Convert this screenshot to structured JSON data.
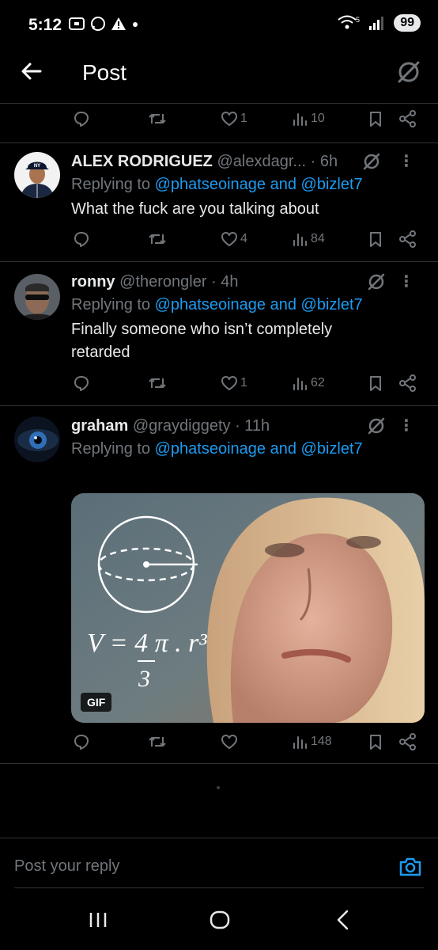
{
  "status_bar": {
    "time": "5:12",
    "battery": "99",
    "signal_label": "5"
  },
  "header": {
    "title": "Post"
  },
  "top_actions": {
    "likes": "1",
    "views": "10"
  },
  "tweets": [
    {
      "name": "ALEX RODRIGUEZ",
      "handle": "@alexdagr...",
      "time": "· 6h",
      "replying_prefix": "Replying to ",
      "mention1": "@phatseoinage",
      "and": " and ",
      "mention2": "@bizlet7",
      "text": "What the fuck are you talking about",
      "likes": "4",
      "views": "84"
    },
    {
      "name": "ronny",
      "handle": "@therongler",
      "time": "· 4h",
      "replying_prefix": "Replying to ",
      "mention1": "@phatseoinage",
      "and": " and ",
      "mention2": "@bizlet7",
      "text": "Finally someone who isn’t completely retarded",
      "likes": "1",
      "views": "62"
    },
    {
      "name": "graham",
      "handle": "@graydiggety",
      "time": "· 11h",
      "replying_prefix": "Replying to ",
      "mention1": "@phatseoinage",
      "and": " and ",
      "mention2": "@bizlet7",
      "gif_badge": "GIF",
      "gif_formula": "V = 4/3 π . r³",
      "likes": "",
      "views": "148"
    }
  ],
  "reply_bar": {
    "placeholder": "Post your reply"
  },
  "colors": {
    "background": "#000000",
    "accent": "#1d9bf0",
    "muted": "#71767b",
    "divider": "#2f3336"
  },
  "icons": [
    "back-arrow-icon",
    "grok-icon",
    "reply-icon",
    "repost-icon",
    "like-icon",
    "views-icon",
    "bookmark-icon",
    "share-icon",
    "more-icon",
    "camera-icon",
    "recents-icon",
    "home-icon",
    "back-icon"
  ]
}
